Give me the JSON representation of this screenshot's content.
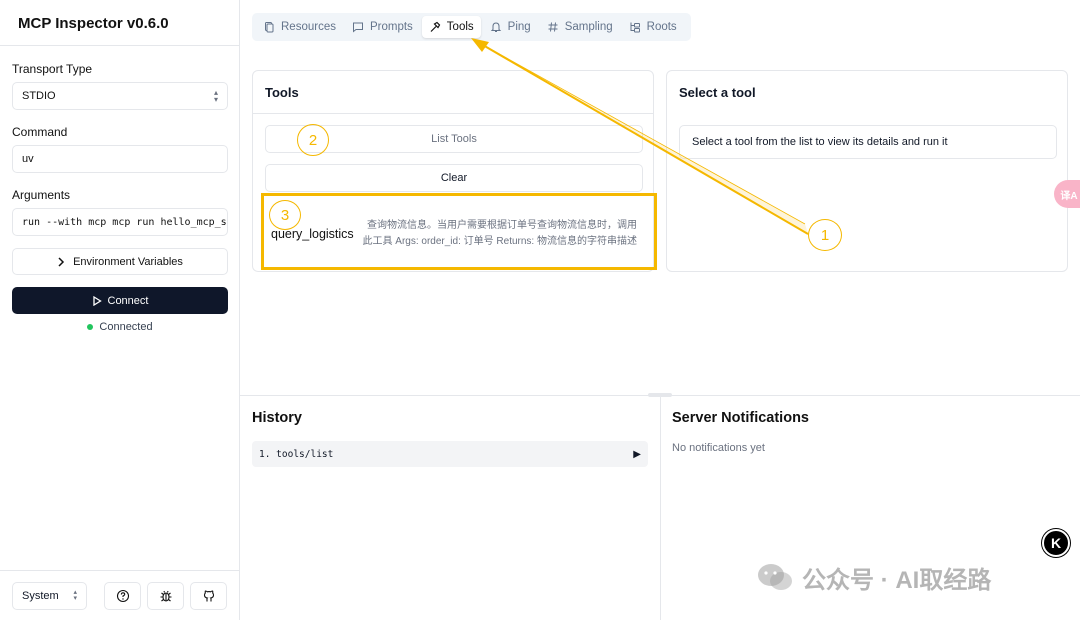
{
  "app": {
    "title": "MCP Inspector v0.6.0"
  },
  "sidebar": {
    "transport_label": "Transport Type",
    "transport_value": "STDIO",
    "command_label": "Command",
    "command_value": "uv",
    "arguments_label": "Arguments",
    "arguments_value": "run --with mcp mcp run hello_mcp_s",
    "env_button": "Environment Variables",
    "connect_button": "Connect",
    "status_text": "Connected",
    "theme_value": "System"
  },
  "tabs": [
    {
      "label": "Resources",
      "icon": "file-icon"
    },
    {
      "label": "Prompts",
      "icon": "message-icon"
    },
    {
      "label": "Tools",
      "icon": "hammer-icon",
      "active": true
    },
    {
      "label": "Ping",
      "icon": "bell-icon"
    },
    {
      "label": "Sampling",
      "icon": "hash-icon"
    },
    {
      "label": "Roots",
      "icon": "folder-tree-icon"
    }
  ],
  "tools_panel": {
    "title": "Tools",
    "list_button": "List Tools",
    "clear_button": "Clear",
    "tool": {
      "name": "query_logistics",
      "description": "查询物流信息。当用户需要根据订单号查询物流信息时，调用此工具 Args: order_id: 订单号 Returns: 物流信息的字符串描述"
    }
  },
  "detail_panel": {
    "title": "Select a tool",
    "hint": "Select a tool from the list to view its details and run it"
  },
  "history": {
    "title": "History",
    "items": [
      "1. tools/list"
    ]
  },
  "notifications": {
    "title": "Server Notifications",
    "empty": "No notifications yet"
  },
  "annotations": {
    "one": "1",
    "two": "2",
    "three": "3",
    "color": "#f5b800"
  },
  "overlay": {
    "translate_label": "译A",
    "badge": "K",
    "watermark": "公众号 · AI取经路"
  }
}
